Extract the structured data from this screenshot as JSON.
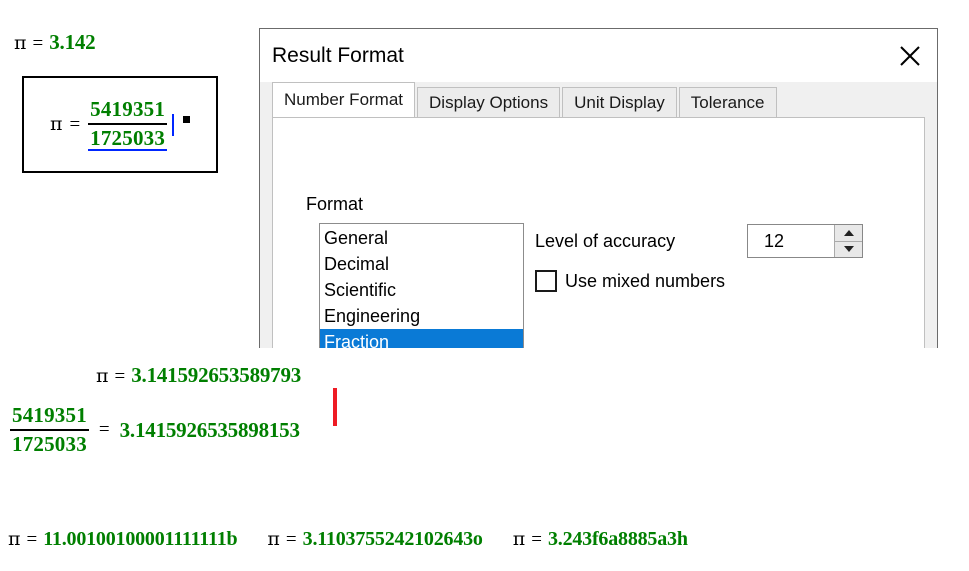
{
  "top_result": {
    "symbol": "π",
    "equals": "=",
    "value": "3.142"
  },
  "fraction_expression": {
    "symbol": "π",
    "equals": "=",
    "numerator": "5419351",
    "denominator": "1725033",
    "caret_name": "text-cursor",
    "placeholder_name": "expression-placeholder"
  },
  "dialog": {
    "title": "Result Format",
    "close_label": "×",
    "tabs": [
      {
        "label": "Number Format",
        "active": true
      },
      {
        "label": "Display Options",
        "active": false
      },
      {
        "label": "Unit Display",
        "active": false
      },
      {
        "label": "Tolerance",
        "active": false
      }
    ],
    "format_group_label": "Format",
    "format_options": [
      {
        "label": "General",
        "selected": false
      },
      {
        "label": "Decimal",
        "selected": false
      },
      {
        "label": "Scientific",
        "selected": false
      },
      {
        "label": "Engineering",
        "selected": false
      },
      {
        "label": "Fraction",
        "selected": true
      }
    ],
    "accuracy": {
      "label": "Level of accuracy",
      "value": "12",
      "increment_label": "▲",
      "decrement_label": "▼"
    },
    "mixed_numbers": {
      "label": "Use mixed numbers",
      "checked": false
    }
  },
  "comparison": {
    "line1": {
      "symbol": "π",
      "equals": "=",
      "value": "3.141592653589793"
    },
    "line2": {
      "numerator": "5419351",
      "denominator": "1725033",
      "equals": "=",
      "value": "3.1415926535898153"
    },
    "marker_color": "#ee1b24"
  },
  "base_conversions": [
    {
      "symbol": "π",
      "equals": "=",
      "value": "11.00100100001111111b"
    },
    {
      "symbol": "π",
      "equals": "=",
      "value": "3.1103755242102643o"
    },
    {
      "symbol": "π",
      "equals": "=",
      "value": "3.243f6a8885a3h"
    }
  ],
  "colors": {
    "result_green": "#007f00",
    "selection_blue": "#0a7ad6",
    "caret_blue": "#0026ff",
    "marker_red": "#ee1b24"
  }
}
